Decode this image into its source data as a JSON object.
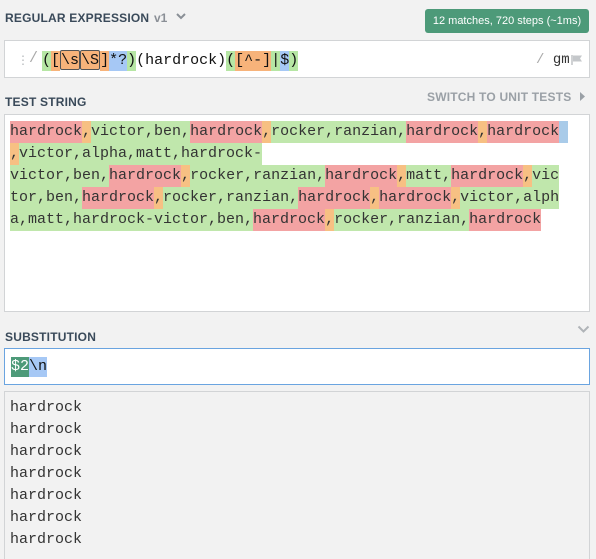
{
  "regex_section": {
    "title": "REGULAR EXPRESSION",
    "version": "v1",
    "match_info": "12 matches, 720 steps (~1ms)",
    "delimiter_open": "/",
    "delimiter_close": "/",
    "flags": "gm",
    "icons": {
      "grip": "grip-dots-icon",
      "version": "chevron-down-icon",
      "flag": "flag-icon"
    },
    "tokens": [
      {
        "text": "(",
        "kind": "group"
      },
      {
        "text": "[",
        "kind": "set"
      },
      {
        "text": "\\s",
        "kind": "set-escape"
      },
      {
        "text": "\\S",
        "kind": "set-escape"
      },
      {
        "text": "]",
        "kind": "set"
      },
      {
        "text": "*?",
        "kind": "quantifier"
      },
      {
        "text": ")",
        "kind": "group"
      },
      {
        "text": "(",
        "kind": "plain"
      },
      {
        "text": "hardrock",
        "kind": "plain"
      },
      {
        "text": ")",
        "kind": "plain"
      },
      {
        "text": "(",
        "kind": "group"
      },
      {
        "text": "[^-]",
        "kind": "set"
      },
      {
        "text": "|",
        "kind": "group"
      },
      {
        "text": "$",
        "kind": "quantifier"
      },
      {
        "text": ")",
        "kind": "group"
      }
    ]
  },
  "test_section": {
    "title": "TEST STRING",
    "switch_label": "SWITCH TO UNIT TESTS",
    "icons": {
      "switch": "caret-right-icon"
    },
    "lines": [
      [
        {
          "t": "hardrock",
          "k": "g"
        },
        {
          "t": ",",
          "k": "s"
        },
        {
          "t": "victor,ben,",
          "k": "m"
        },
        {
          "t": "hardrock",
          "k": "g"
        },
        {
          "t": ",",
          "k": "s"
        },
        {
          "t": "rocker,ranzian,",
          "k": "m"
        },
        {
          "t": "hardrock",
          "k": "g"
        },
        {
          "t": ",",
          "k": "s"
        },
        {
          "t": "hardrock",
          "k": "g"
        },
        {
          "t": " ",
          "k": "b"
        }
      ],
      [
        {
          "t": ",",
          "k": "s"
        },
        {
          "t": "victor,alpha,matt,hardrock-",
          "k": "m"
        }
      ],
      [
        {
          "t": "victor,ben,",
          "k": "m"
        },
        {
          "t": "hardrock",
          "k": "g"
        },
        {
          "t": ",",
          "k": "s"
        },
        {
          "t": "rocker,ranzian,",
          "k": "m"
        },
        {
          "t": "hardrock",
          "k": "g"
        },
        {
          "t": ",",
          "k": "s"
        },
        {
          "t": "matt,",
          "k": "m"
        },
        {
          "t": "hardrock",
          "k": "g"
        },
        {
          "t": ",",
          "k": "s"
        },
        {
          "t": "vic",
          "k": "m"
        }
      ],
      [
        {
          "t": "tor,ben,",
          "k": "m"
        },
        {
          "t": "hardrock",
          "k": "g"
        },
        {
          "t": ",",
          "k": "s"
        },
        {
          "t": "rocker,ranzian,",
          "k": "m"
        },
        {
          "t": "hardrock",
          "k": "g"
        },
        {
          "t": ",",
          "k": "s"
        },
        {
          "t": "hardrock",
          "k": "g"
        },
        {
          "t": ",",
          "k": "s"
        },
        {
          "t": "victor,alph",
          "k": "m"
        }
      ],
      [
        {
          "t": "a,matt,hardrock-victor,ben,",
          "k": "m"
        },
        {
          "t": "hardrock",
          "k": "g"
        },
        {
          "t": ",",
          "k": "s"
        },
        {
          "t": "rocker,ranzian,",
          "k": "m"
        },
        {
          "t": "hardrock",
          "k": "g"
        }
      ]
    ],
    "colors": {
      "match": "#c0e7ac",
      "group2": "#f3a3a3",
      "group3": "#f7c083",
      "linebreak": "#a9cbe9"
    }
  },
  "substitution_section": {
    "title": "SUBSTITUTION",
    "icons": {
      "collapse": "chevron-down-icon"
    },
    "tokens": [
      {
        "text": "$2",
        "kind": "ref"
      },
      {
        "text": "\\n",
        "kind": "escape"
      }
    ],
    "results": [
      "hardrock",
      "hardrock",
      "hardrock",
      "hardrock",
      "hardrock",
      "hardrock",
      "hardrock"
    ]
  },
  "colors": {
    "badge": "#4d9a79",
    "header_text": "#3a4a5a",
    "focus_border": "#6aa4e0"
  }
}
